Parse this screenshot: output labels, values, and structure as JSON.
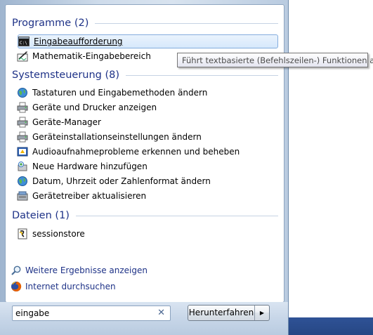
{
  "groups": {
    "programs": {
      "header": "Programme (2)",
      "items": [
        {
          "label": "Eingabeaufforderung",
          "icon": "cmd-icon"
        },
        {
          "label": "Mathematik-Eingabebereich",
          "icon": "math-input-icon"
        }
      ]
    },
    "control_panel": {
      "header": "Systemsteuerung (8)",
      "items": [
        {
          "label": "Tastaturen und Eingabemethoden ändern",
          "icon": "globe-icon"
        },
        {
          "label": "Geräte und Drucker anzeigen",
          "icon": "printer-icon"
        },
        {
          "label": "Geräte-Manager",
          "icon": "printer-icon"
        },
        {
          "label": "Geräteinstallationseinstellungen ändern",
          "icon": "printer-icon"
        },
        {
          "label": "Audioaufnahmeprobleme erkennen und beheben",
          "icon": "troubleshoot-icon"
        },
        {
          "label": "Neue Hardware hinzufügen",
          "icon": "add-hardware-icon"
        },
        {
          "label": "Datum, Uhrzeit oder Zahlenformat ändern",
          "icon": "globe-icon"
        },
        {
          "label": "Gerätetreiber aktualisieren",
          "icon": "driver-icon"
        }
      ]
    },
    "files": {
      "header": "Dateien (1)",
      "items": [
        {
          "label": "sessionstore",
          "icon": "script-file-icon"
        }
      ]
    }
  },
  "links": {
    "more_results": "Weitere Ergebnisse anzeigen",
    "internet_search": "Internet durchsuchen"
  },
  "tooltip": "Führt textbasierte (Befehlszeilen-) Funktionen aus.",
  "search": {
    "value": "eingabe"
  },
  "shutdown": {
    "label": "Herunterfahren"
  },
  "colors": {
    "header": "#1e3287",
    "selection_border": "#84acdd",
    "taskbar": "#264784"
  }
}
